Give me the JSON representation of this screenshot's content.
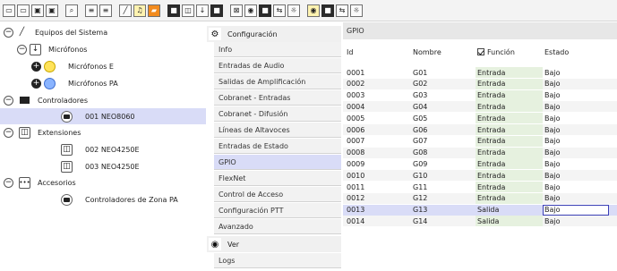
{
  "toolbar": {
    "buttons": [
      {
        "icon": "new-document-icon",
        "glyph": "▭"
      },
      {
        "icon": "new-window-icon",
        "glyph": "▭"
      },
      {
        "icon": "save-icon",
        "glyph": "▣"
      },
      {
        "icon": "save-as-icon",
        "glyph": "▣"
      },
      {
        "icon": "search-icon",
        "glyph": "⌕"
      },
      {
        "icon": "align-icon",
        "glyph": "≡"
      },
      {
        "icon": "list-icon",
        "glyph": "≡"
      },
      {
        "icon": "line-tool-icon",
        "glyph": "╱"
      },
      {
        "icon": "music-note-icon",
        "glyph": "♫"
      },
      {
        "icon": "image-icon",
        "glyph": "▰"
      },
      {
        "icon": "display-icon",
        "glyph": "■"
      },
      {
        "icon": "device-icon",
        "glyph": "◫"
      },
      {
        "icon": "microphone-icon",
        "glyph": "↓"
      },
      {
        "icon": "speaker-icon",
        "glyph": "■"
      },
      {
        "icon": "chart-icon",
        "glyph": "⊠"
      },
      {
        "icon": "mic-blue-icon",
        "glyph": "◉"
      },
      {
        "icon": "monitor-icon",
        "glyph": "■"
      },
      {
        "icon": "arrows-icon",
        "glyph": "⇆"
      },
      {
        "icon": "gear-icon",
        "glyph": "☼"
      },
      {
        "icon": "mic-yellow-icon",
        "glyph": "◉"
      },
      {
        "icon": "screen-icon",
        "glyph": "■"
      },
      {
        "icon": "export-icon",
        "glyph": "⇆"
      },
      {
        "icon": "settings-icon",
        "glyph": "☼"
      }
    ]
  },
  "tree": {
    "items": [
      {
        "label": "Equipos del Sistema",
        "expander": "−",
        "icon": "pencil-icon"
      },
      {
        "label": "Micrófonos",
        "expander": "−",
        "icon": "microphone-icon"
      },
      {
        "label": "Micrófonos E",
        "expander": "+",
        "icon": "mic-yellow-icon"
      },
      {
        "label": "Micrófonos PA",
        "expander": "+",
        "icon": "mic-blue-icon"
      },
      {
        "label": "Controladores",
        "expander": "−",
        "icon": "monitor-icon"
      },
      {
        "label": "001 NEO8060",
        "expander": "",
        "icon": "device-icon"
      },
      {
        "label": "Extensiones",
        "expander": "−",
        "icon": "extension-icon"
      },
      {
        "label": "002 NEO4250E",
        "expander": "",
        "icon": "extension-device-icon"
      },
      {
        "label": "003 NEO4250E",
        "expander": "",
        "icon": "extension-device-icon"
      },
      {
        "label": "Accesorios",
        "expander": "−",
        "icon": "more-icon"
      },
      {
        "label": "Controladores de Zona PA",
        "expander": "",
        "icon": "zone-controller-icon"
      }
    ]
  },
  "nav": {
    "config_header": "Configuración",
    "items": [
      "Info",
      "Entradas de Audio",
      "Salidas de Amplificación",
      "Cobranet - Entradas",
      "Cobranet - Difusión",
      "Líneas de Altavoces",
      "Entradas de Estado",
      "GPIO",
      "FlexNet",
      "Control de Acceso",
      "Configuración PTT",
      "Avanzado"
    ],
    "view_header": "Ver",
    "view_items": [
      "Logs"
    ]
  },
  "gpio": {
    "title": "GPIO",
    "columns": {
      "id": "Id",
      "name": "Nombre",
      "function": "Función",
      "state": "Estado"
    },
    "rows": [
      {
        "id": "0001",
        "name": "G01",
        "function": "Entrada",
        "state": "Bajo"
      },
      {
        "id": "0002",
        "name": "G02",
        "function": "Entrada",
        "state": "Bajo"
      },
      {
        "id": "0003",
        "name": "G03",
        "function": "Entrada",
        "state": "Bajo"
      },
      {
        "id": "0004",
        "name": "G04",
        "function": "Entrada",
        "state": "Bajo"
      },
      {
        "id": "0005",
        "name": "G05",
        "function": "Entrada",
        "state": "Bajo"
      },
      {
        "id": "0006",
        "name": "G06",
        "function": "Entrada",
        "state": "Bajo"
      },
      {
        "id": "0007",
        "name": "G07",
        "function": "Entrada",
        "state": "Bajo"
      },
      {
        "id": "0008",
        "name": "G08",
        "function": "Entrada",
        "state": "Bajo"
      },
      {
        "id": "0009",
        "name": "G09",
        "function": "Entrada",
        "state": "Bajo"
      },
      {
        "id": "0010",
        "name": "G10",
        "function": "Entrada",
        "state": "Bajo"
      },
      {
        "id": "0011",
        "name": "G11",
        "function": "Entrada",
        "state": "Bajo"
      },
      {
        "id": "0012",
        "name": "G12",
        "function": "Entrada",
        "state": "Bajo"
      },
      {
        "id": "0013",
        "name": "G13",
        "function": "Salida",
        "state": "Bajo"
      },
      {
        "id": "0014",
        "name": "G14",
        "function": "Salida",
        "state": "Bajo"
      }
    ]
  },
  "colors": {
    "selection": "#d9dcf7",
    "function_cell": "#e6f1df",
    "edit_border": "#3a3fb5"
  }
}
